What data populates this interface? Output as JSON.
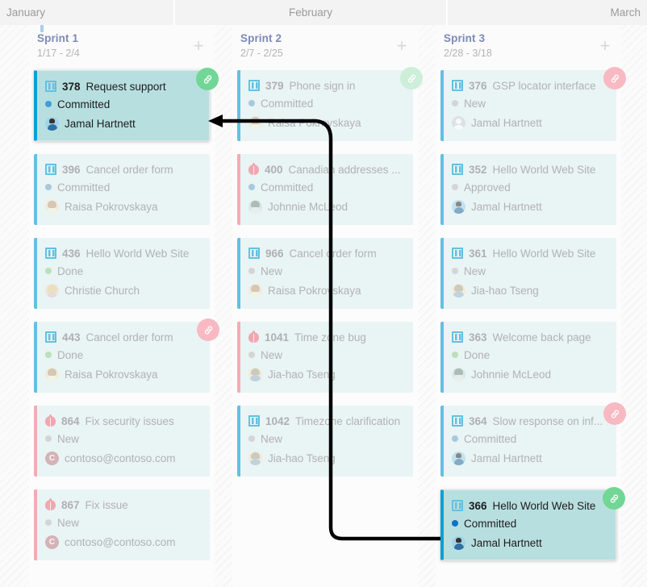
{
  "timeline": {
    "months": [
      {
        "label": "January",
        "align": "left"
      },
      {
        "label": "February",
        "align": "center"
      },
      {
        "label": "March",
        "align": "right"
      }
    ],
    "today_marker": true
  },
  "colors": {
    "accent_blue": "#64c0e0",
    "selected_card_bg": "#b8dfe0",
    "selected_card_border": "#0c9fd8",
    "card_bg": "#e9f4f5",
    "bug_border": "#f3acb4",
    "state_committed": "#3f9ed8",
    "state_new": "#c9c9c9",
    "state_done": "#8ed68e",
    "state_approved": "#c9c9c9",
    "link_badge_green": "#72d696",
    "link_badge_red": "#f5a0ab",
    "header_bg": "#f3f3f3",
    "month_text": "#9a9a9a",
    "sprint_name": "#7c8ab5"
  },
  "add_button_label": "+",
  "columns": [
    {
      "name": "Sprint 1",
      "dates": "1/17 - 2/4",
      "cards": [
        {
          "icon": "story-icon",
          "type": "story",
          "id": "378",
          "title": "Request support",
          "state": "Committed",
          "state_color": "#3f9ed8",
          "person": "Jamal Hartnett",
          "avatar": "av-jamal",
          "selected": true,
          "link_badge": {
            "show": true,
            "color": "green",
            "dim": false
          }
        },
        {
          "icon": "story-icon",
          "type": "story",
          "id": "396",
          "title": "Cancel order form",
          "state": "Committed",
          "state_color": "#a8c8de",
          "person": "Raisa Pokrovskaya",
          "avatar": "av-raisa",
          "selected": false,
          "link_badge": {
            "show": false,
            "color": "",
            "dim": true
          }
        },
        {
          "icon": "story-icon",
          "type": "story",
          "id": "436",
          "title": "Hello World Web Site",
          "state": "Done",
          "state_color": "#bbdfbb",
          "person": "Christie Church",
          "avatar": "av-christie",
          "selected": false,
          "link_badge": {
            "show": false,
            "color": "",
            "dim": true
          }
        },
        {
          "icon": "story-icon",
          "type": "story",
          "id": "443",
          "title": "Cancel order form",
          "state": "Done",
          "state_color": "#bbdfbb",
          "person": "Raisa Pokrovskaya",
          "avatar": "av-raisa",
          "selected": false,
          "link_badge": {
            "show": true,
            "color": "red",
            "dim": true
          }
        },
        {
          "icon": "bug-icon",
          "type": "bug",
          "id": "864",
          "title": "Fix security issues",
          "state": "New",
          "state_color": "#d5d5d5",
          "person": "contoso@contoso.com",
          "avatar": "av-initial",
          "avatar_initial": "C",
          "selected": false,
          "link_badge": {
            "show": false,
            "color": "",
            "dim": true
          }
        },
        {
          "icon": "bug-icon",
          "type": "bug",
          "id": "867",
          "title": "Fix issue",
          "state": "New",
          "state_color": "#d5d5d5",
          "person": "contoso@contoso.com",
          "avatar": "av-initial",
          "avatar_initial": "C",
          "selected": false,
          "link_badge": {
            "show": false,
            "color": "",
            "dim": true
          }
        }
      ]
    },
    {
      "name": "Sprint 2",
      "dates": "2/7 - 2/25",
      "cards": [
        {
          "icon": "story-icon",
          "type": "story",
          "id": "379",
          "title": "Phone sign in",
          "state": "Committed",
          "state_color": "#a8c8de",
          "person": "Raisa Pokrovskaya",
          "avatar": "av-raisa",
          "selected": false,
          "link_badge": {
            "show": true,
            "color": "green",
            "dim": true
          }
        },
        {
          "icon": "bug-icon",
          "type": "bug",
          "id": "400",
          "title": "Canadian addresses ...",
          "state": "Committed",
          "state_color": "#a8c8de",
          "person": "Johnnie McLeod",
          "avatar": "av-johnnie",
          "selected": false,
          "link_badge": {
            "show": false,
            "color": "",
            "dim": true
          }
        },
        {
          "icon": "story-icon",
          "type": "story",
          "id": "966",
          "title": "Cancel order form",
          "state": "New",
          "state_color": "#d5d5d5",
          "person": "Raisa Pokrovskaya",
          "avatar": "av-raisa",
          "selected": false,
          "link_badge": {
            "show": false,
            "color": "",
            "dim": true
          }
        },
        {
          "icon": "bug-icon",
          "type": "bug",
          "id": "1041",
          "title": "Time zone bug",
          "state": "New",
          "state_color": "#d5d5d5",
          "person": "Jia-hao Tseng",
          "avatar": "av-jiahao",
          "selected": false,
          "link_badge": {
            "show": false,
            "color": "",
            "dim": true
          }
        },
        {
          "icon": "story-icon",
          "type": "story",
          "id": "1042",
          "title": "Timezone clarification",
          "state": "New",
          "state_color": "#d5d5d5",
          "person": "Jia-hao Tseng",
          "avatar": "av-jiahao",
          "selected": false,
          "link_badge": {
            "show": false,
            "color": "",
            "dim": true
          }
        }
      ]
    },
    {
      "name": "Sprint 3",
      "dates": "2/28 - 3/18",
      "cards": [
        {
          "icon": "story-icon",
          "type": "story",
          "id": "376",
          "title": "GSP locator interface",
          "state": "New",
          "state_color": "#d5d5d5",
          "person": "Jamal Hartnett",
          "avatar": "av-generic",
          "selected": false,
          "link_badge": {
            "show": true,
            "color": "red",
            "dim": true
          }
        },
        {
          "icon": "story-icon",
          "type": "story",
          "id": "352",
          "title": "Hello World Web Site",
          "state": "Approved",
          "state_color": "#d5d5d5",
          "person": "Jamal Hartnett",
          "avatar": "av-jamal",
          "selected": false,
          "link_badge": {
            "show": false,
            "color": "",
            "dim": true
          }
        },
        {
          "icon": "story-icon",
          "type": "story",
          "id": "361",
          "title": "Hello World Web Site",
          "state": "New",
          "state_color": "#d5d5d5",
          "person": "Jia-hao Tseng",
          "avatar": "av-jiahao",
          "selected": false,
          "link_badge": {
            "show": false,
            "color": "",
            "dim": true
          }
        },
        {
          "icon": "story-icon",
          "type": "story",
          "id": "363",
          "title": "Welcome back page",
          "state": "Done",
          "state_color": "#bbdfbb",
          "person": "Johnnie McLeod",
          "avatar": "av-johnnie",
          "selected": false,
          "link_badge": {
            "show": false,
            "color": "",
            "dim": true
          }
        },
        {
          "icon": "story-icon",
          "type": "story",
          "id": "364",
          "title": "Slow response on inf...",
          "state": "Committed",
          "state_color": "#a8c8de",
          "person": "Jamal Hartnett",
          "avatar": "av-jamal",
          "selected": false,
          "link_badge": {
            "show": true,
            "color": "red",
            "dim": true
          }
        },
        {
          "icon": "story-icon",
          "type": "story",
          "id": "366",
          "title": "Hello World Web Site",
          "state": "Committed",
          "state_color": "#0f72c4",
          "person": "Jamal Hartnett",
          "avatar": "av-jamal",
          "selected": true,
          "link_badge": {
            "show": true,
            "color": "green",
            "dim": false
          }
        }
      ]
    }
  ],
  "dependency_arrow": {
    "from_card_id": "366",
    "to_card_id": "378",
    "color": "#000000"
  }
}
